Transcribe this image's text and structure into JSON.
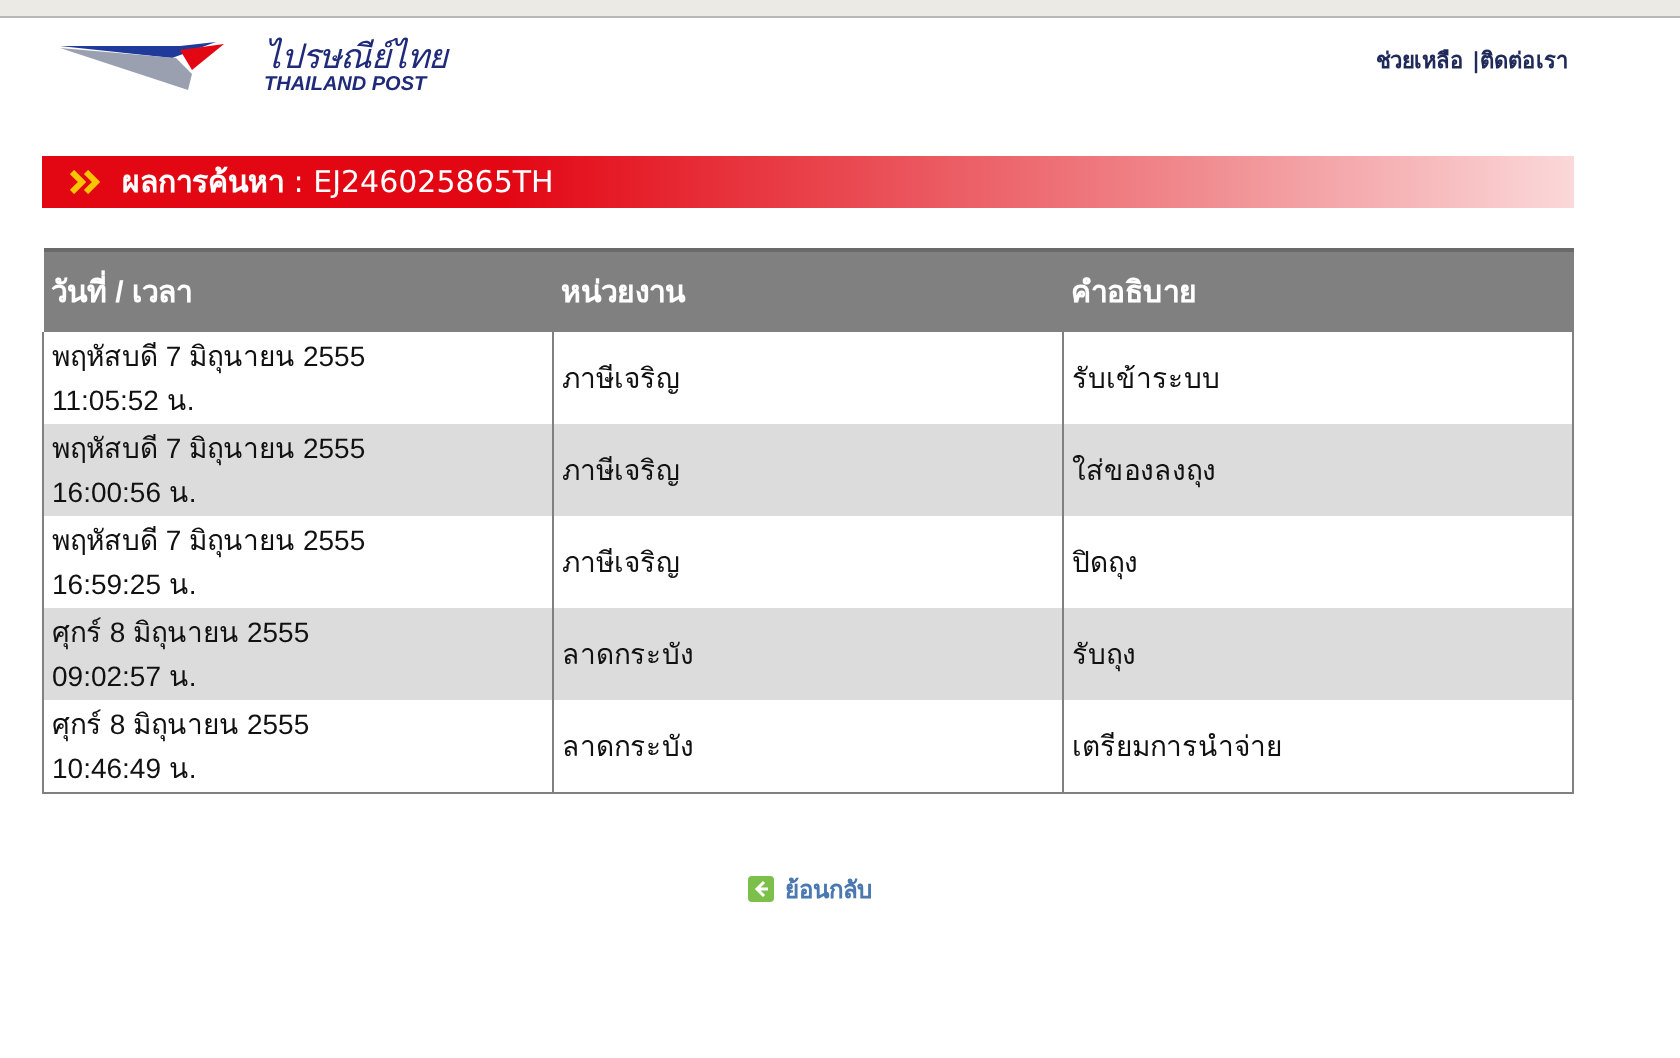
{
  "logo": {
    "thai": "ไปรษณีย์ไทย",
    "english": "THAILAND POST"
  },
  "top_links": [
    "ช่วยเหลือ",
    "|ติดต่อเรา"
  ],
  "result_bar": {
    "title": "**ผลการค้นหา** : EJ246025865TH"
  },
  "table": {
    "columns": [
      "วันที่ / เวลา",
      "หน่วยงาน",
      "คำอธิบาย"
    ],
    "rows": [
      {
        "date": "พฤหัสบดี 7 มิถุนายน 2555",
        "time": "11:05:52 น.",
        "office": "ภาษีเจริญ",
        "description": "รับเข้าระบบ"
      },
      {
        "date": "พฤหัสบดี 7 มิถุนายน 2555",
        "time": "16:00:56 น.",
        "office": "ภาษีเจริญ",
        "description": "ใส่ของลงถุง"
      },
      {
        "date": "พฤหัสบดี 7 มิถุนายน 2555",
        "time": "16:59:25 น.",
        "office": "ภาษีเจริญ",
        "description": "ปิดถุง"
      },
      {
        "date": "ศุกร์ 8 มิถุนายน 2555",
        "time": "09:02:57 น.",
        "office": "ลาดกระบัง",
        "description": "รับถุง"
      },
      {
        "date": "ศุกร์ 8 มิถุนายน 2555",
        "time": "10:46:49 น.",
        "office": "ลาดกระบัง",
        "description": "เตรียมการนำจ่าย"
      }
    ]
  },
  "back_link": "ย้อนกลับ"
}
